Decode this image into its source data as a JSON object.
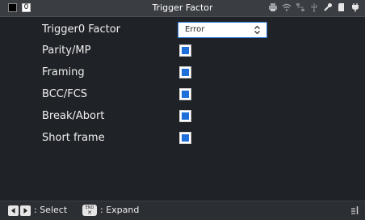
{
  "window": {
    "title": "Trigger Factor",
    "channel_number": "0"
  },
  "status_icons": [
    "printer-icon",
    "wifi-icon",
    "network-icon",
    "usb-icon",
    "tool-icon",
    "sd-card-icon",
    "power-plug-icon"
  ],
  "settings": {
    "factor_label": "Trigger0 Factor",
    "factor_value": "Error",
    "items": [
      {
        "label": "Parity/MP",
        "checked": true
      },
      {
        "label": "Framing",
        "checked": true
      },
      {
        "label": "BCC/FCS",
        "checked": true
      },
      {
        "label": "Break/Abort",
        "checked": true
      },
      {
        "label": "Short frame",
        "checked": true
      }
    ]
  },
  "footer": {
    "select_hint": ": Select",
    "expand_hint": ": Expand",
    "end_key_top": "END",
    "end_key_bottom": "✕"
  },
  "colors": {
    "accent": "#1e6fd9",
    "background": "#1f2226",
    "statusbar": "#3a3d42"
  }
}
